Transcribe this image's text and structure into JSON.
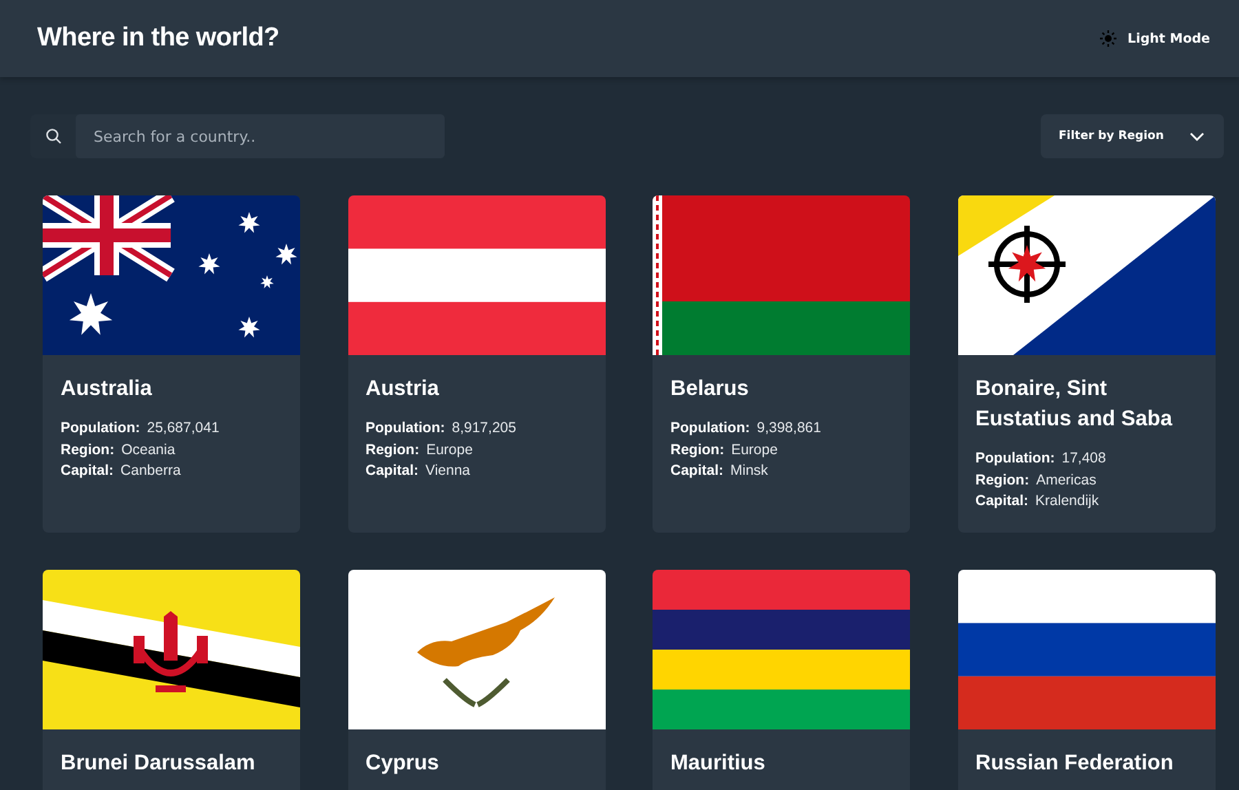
{
  "header": {
    "title": "Where in the world?",
    "mode_label": "Light Mode"
  },
  "search": {
    "placeholder": "Search for a country.."
  },
  "filter": {
    "label": "Filter by Region"
  },
  "countries": [
    {
      "name": "Australia",
      "details": [
        {
          "label": "Population:",
          "value": "25,687,041"
        },
        {
          "label": "Region:",
          "value": "Oceania"
        },
        {
          "label": "Capital:",
          "value": "Canberra"
        }
      ]
    },
    {
      "name": "Austria",
      "details": [
        {
          "label": "Population:",
          "value": "8,917,205"
        },
        {
          "label": "Region:",
          "value": "Europe"
        },
        {
          "label": "Capital:",
          "value": "Vienna"
        }
      ]
    },
    {
      "name": "Belarus",
      "details": [
        {
          "label": "Population:",
          "value": "9,398,861"
        },
        {
          "label": "Region:",
          "value": "Europe"
        },
        {
          "label": "Capital:",
          "value": "Minsk"
        }
      ]
    },
    {
      "name": "Bonaire, Sint Eustatius and Saba",
      "details": [
        {
          "label": "Population:",
          "value": "17,408"
        },
        {
          "label": "Region:",
          "value": "Americas"
        },
        {
          "label": "Capital:",
          "value": "Kralendijk"
        }
      ]
    },
    {
      "name": "Brunei Darussalam"
    },
    {
      "name": "Cyprus"
    },
    {
      "name": "Mauritius"
    },
    {
      "name": "Russian Federation"
    }
  ]
}
